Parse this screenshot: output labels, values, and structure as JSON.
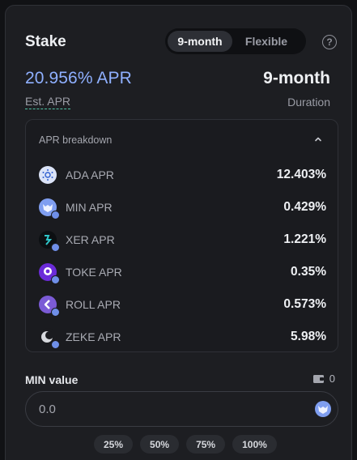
{
  "stake": {
    "title": "Stake",
    "duration_tabs": [
      {
        "label": "9-month",
        "active": true
      },
      {
        "label": "Flexible",
        "active": false
      }
    ],
    "help_icon": "question-circle-icon",
    "apr_value": "20.956% APR",
    "apr_label": "Est. APR",
    "duration_value": "9-month",
    "duration_label": "Duration"
  },
  "breakdown": {
    "title": "APR breakdown",
    "chevron_icon": "chevron-up-icon",
    "items": [
      {
        "name": "ADA APR",
        "value": "12.403%",
        "icon": "ada-token-icon",
        "color": "#2f5fd0"
      },
      {
        "name": "MIN APR",
        "value": "0.429%",
        "icon": "min-token-icon",
        "color": "#7f9ef0"
      },
      {
        "name": "XER APR",
        "value": "1.221%",
        "icon": "xer-token-icon",
        "color": "#111418"
      },
      {
        "name": "TOKE APR",
        "value": "0.35%",
        "icon": "toke-token-icon",
        "color": "#6b2bd9"
      },
      {
        "name": "ROLL APR",
        "value": "0.573%",
        "icon": "roll-token-icon",
        "color": "#7b5bd6"
      },
      {
        "name": "ZEKE APR",
        "value": "5.98%",
        "icon": "zeke-token-icon",
        "color": "#d7d9de"
      }
    ]
  },
  "min_input": {
    "label": "MIN value",
    "wallet_icon": "wallet-icon",
    "balance": "0",
    "placeholder": "0.0",
    "token_icon": "min-token-icon"
  },
  "percent_buttons": [
    "25%",
    "50%",
    "75%",
    "100%"
  ]
}
